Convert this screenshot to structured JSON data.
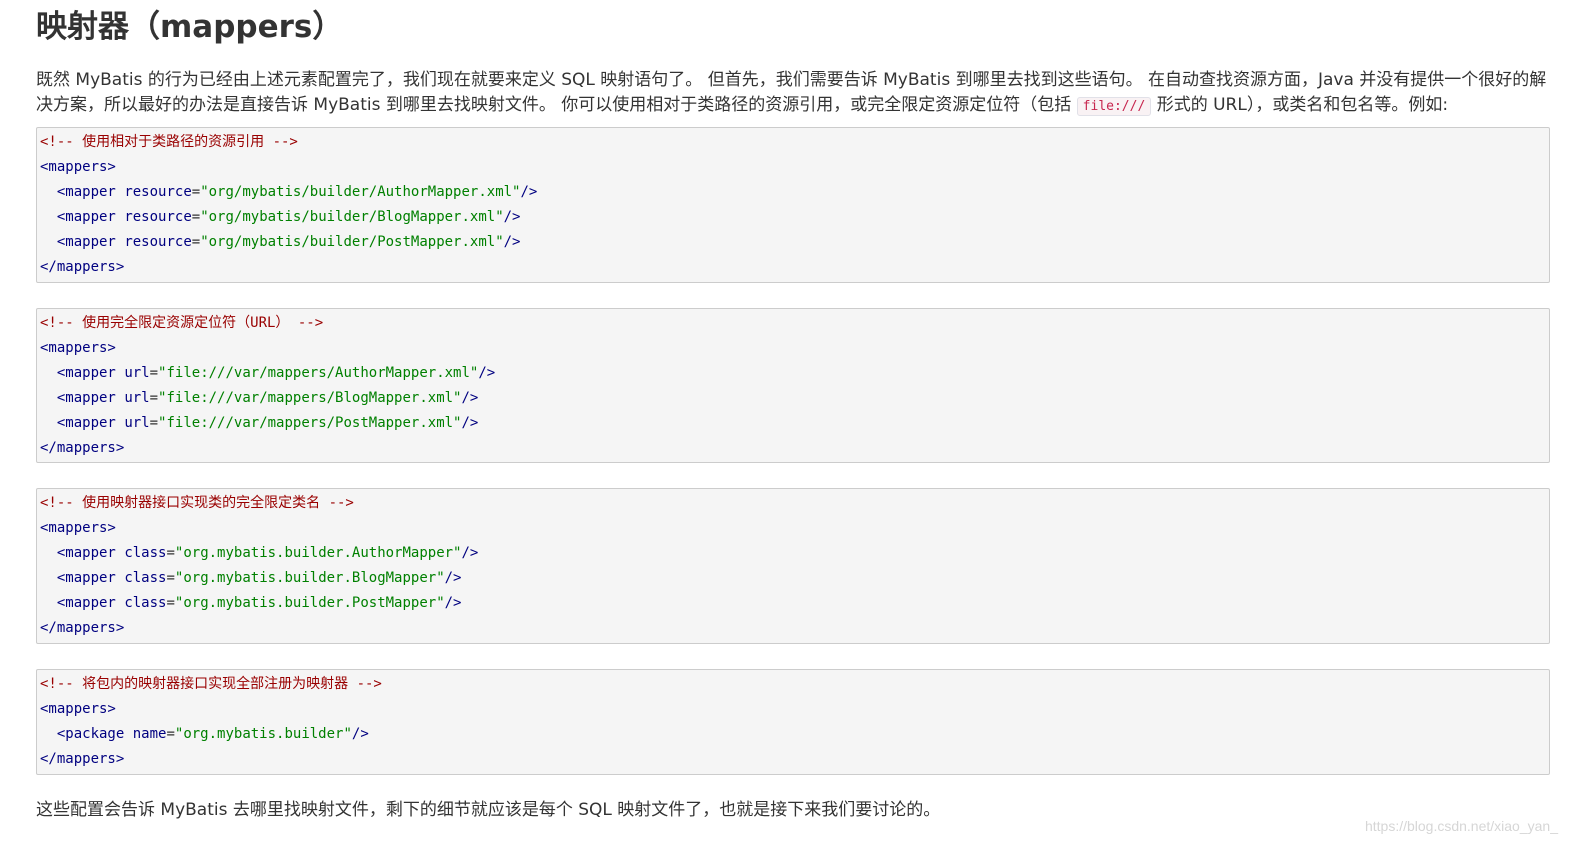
{
  "heading": "映射器（mappers）",
  "intro": {
    "text_before": "既然 MyBatis 的行为已经由上述元素配置完了，我们现在就要来定义 SQL 映射语句了。 但首先，我们需要告诉 MyBatis 到哪里去找到这些语句。 在自动查找资源方面，Java 并没有提供一个很好的解决方案，所以最好的办法是直接告诉 MyBatis 到哪里去找映射文件。 你可以使用相对于类路径的资源引用，或完全限定资源定位符（包括 ",
    "code": "file:///",
    "text_after": " 形式的 URL），或类名和包名等。例如:"
  },
  "code_blocks": [
    {
      "comment": "<!-- 使用相对于类路径的资源引用 -->",
      "open": "<mappers>",
      "lines": [
        {
          "tag": "<mapper",
          "attr": "resource",
          "value": "\"org/mybatis/builder/AuthorMapper.xml\"",
          "end": "/>"
        },
        {
          "tag": "<mapper",
          "attr": "resource",
          "value": "\"org/mybatis/builder/BlogMapper.xml\"",
          "end": "/>"
        },
        {
          "tag": "<mapper",
          "attr": "resource",
          "value": "\"org/mybatis/builder/PostMapper.xml\"",
          "end": "/>"
        }
      ],
      "close": "</mappers>"
    },
    {
      "comment": "<!-- 使用完全限定资源定位符（URL） -->",
      "open": "<mappers>",
      "lines": [
        {
          "tag": "<mapper",
          "attr": "url",
          "value": "\"file:///var/mappers/AuthorMapper.xml\"",
          "end": "/>"
        },
        {
          "tag": "<mapper",
          "attr": "url",
          "value": "\"file:///var/mappers/BlogMapper.xml\"",
          "end": "/>"
        },
        {
          "tag": "<mapper",
          "attr": "url",
          "value": "\"file:///var/mappers/PostMapper.xml\"",
          "end": "/>"
        }
      ],
      "close": "</mappers>"
    },
    {
      "comment": "<!-- 使用映射器接口实现类的完全限定类名 -->",
      "open": "<mappers>",
      "lines": [
        {
          "tag": "<mapper",
          "attr": "class",
          "value": "\"org.mybatis.builder.AuthorMapper\"",
          "end": "/>"
        },
        {
          "tag": "<mapper",
          "attr": "class",
          "value": "\"org.mybatis.builder.BlogMapper\"",
          "end": "/>"
        },
        {
          "tag": "<mapper",
          "attr": "class",
          "value": "\"org.mybatis.builder.PostMapper\"",
          "end": "/>"
        }
      ],
      "close": "</mappers>"
    },
    {
      "comment": "<!-- 将包内的映射器接口实现全部注册为映射器 -->",
      "open": "<mappers>",
      "lines": [
        {
          "tag": "<package",
          "attr": "name",
          "value": "\"org.mybatis.builder\"",
          "end": "/>"
        }
      ],
      "close": "</mappers>"
    }
  ],
  "outro": "这些配置会告诉 MyBatis 去哪里找映射文件，剩下的细节就应该是每个 SQL 映射文件了，也就是接下来我们要讨论的。",
  "watermark": "https://blog.csdn.net/xiao_yan_"
}
